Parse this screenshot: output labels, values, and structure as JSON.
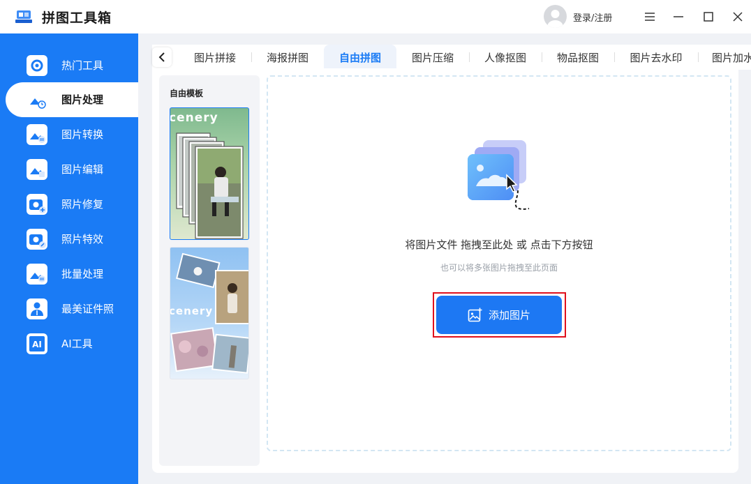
{
  "app": {
    "title": "拼图工具箱",
    "login_label": "登录/注册"
  },
  "sidebar": {
    "items": [
      {
        "label": "热门工具",
        "icon": "gear-icon"
      },
      {
        "label": "图片处理",
        "icon": "image-process-icon"
      },
      {
        "label": "图片转换",
        "icon": "image-convert-icon"
      },
      {
        "label": "图片编辑",
        "icon": "image-edit-icon"
      },
      {
        "label": "照片修复",
        "icon": "photo-repair-icon"
      },
      {
        "label": "照片特效",
        "icon": "photo-effect-icon"
      },
      {
        "label": "批量处理",
        "icon": "batch-icon"
      },
      {
        "label": "最美证件照",
        "icon": "id-photo-icon"
      },
      {
        "label": "AI工具",
        "icon": "ai-icon"
      }
    ],
    "active_index": 1
  },
  "tabs": [
    {
      "label": "图片拼接"
    },
    {
      "label": "海报拼图"
    },
    {
      "label": "自由拼图"
    },
    {
      "label": "图片压缩"
    },
    {
      "label": "人像抠图"
    },
    {
      "label": "物品抠图"
    },
    {
      "label": "图片去水印"
    },
    {
      "label": "图片加水"
    }
  ],
  "active_tab_index": 2,
  "templates": {
    "title": "自由模板",
    "items": [
      {
        "word": "cenery"
      },
      {
        "word": "cenery"
      }
    ]
  },
  "drop_zone": {
    "main_text": "将图片文件 拖拽至此处 或 点击下方按钮",
    "sub_text": "也可以将多张图片拖拽至此页面",
    "button_label": "添加图片"
  },
  "colors": {
    "accent": "#1a7bf5",
    "button": "#1d78f3",
    "highlight_frame": "#e0101c"
  }
}
